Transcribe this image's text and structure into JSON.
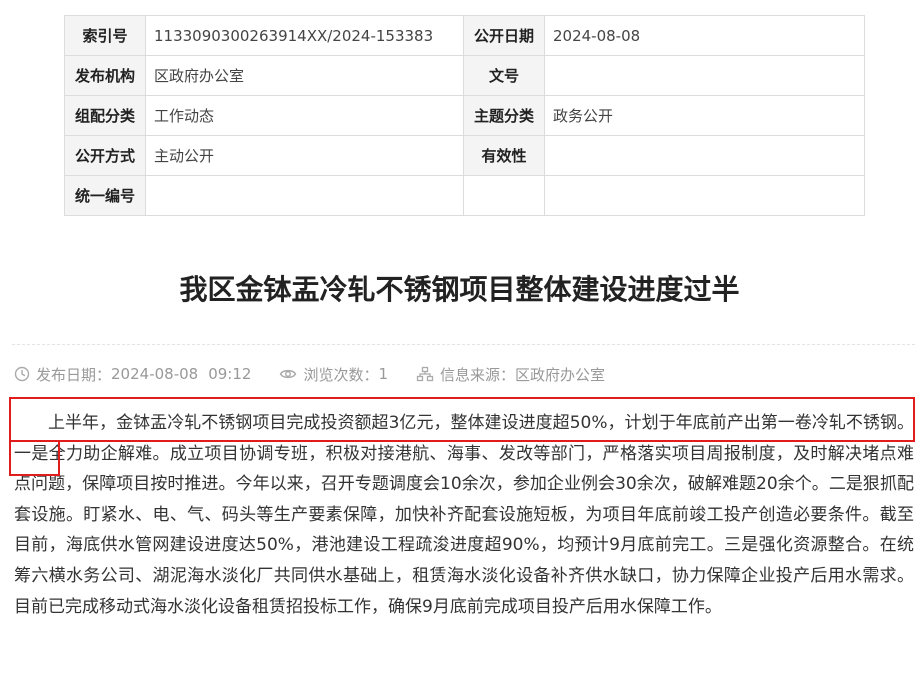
{
  "info_table": {
    "rows": [
      [
        {
          "label": "索引号",
          "value": "113309030026391 4XX/2024-153383"
        },
        {
          "label": "公开日期",
          "value": "2024-08-08"
        }
      ],
      [
        {
          "label": "发布机构",
          "value": "区政府办公室"
        },
        {
          "label": "文号",
          "value": ""
        }
      ],
      [
        {
          "label": "组配分类",
          "value": "工作动态"
        },
        {
          "label": "主题分类",
          "value": "政务公开"
        }
      ],
      [
        {
          "label": "公开方式",
          "value": "主动公开"
        },
        {
          "label": "有效性",
          "value": ""
        }
      ],
      [
        {
          "label": "统一编号",
          "value": ""
        },
        {
          "label": "",
          "value": ""
        }
      ]
    ]
  },
  "article": {
    "title": "我区金钵盂冷轧不锈钢项目整体建设进度过半",
    "meta": {
      "publish_label": "发布日期：",
      "publish_date": "2024-08-08",
      "publish_time": "09:12",
      "views_label": "浏览次数：",
      "views": "1",
      "source_label": "信息来源：",
      "source": "区政府办公室"
    },
    "highlighted_text": "上半年，金钵盂冷轧不锈钢项目完成投资额超3亿元，整体建设进度超50%，计划于年底前产出第一卷冷轧不锈钢。",
    "body_rest": "一是全力助企解难。成立项目协调专班，积极对接港航、海事、发改等部门，严格落实项目周报制度，及时解决堵点难点问题，保障项目按时推进。今年以来，召开专题调度会10余次，参加企业例会30余次，破解难题20余个。二是狠抓配套设施。盯紧水、电、气、码头等生产要素保障，加快补齐配套设施短板，为项目年底前竣工投产创造必要条件。截至目前，海底供水管网建设进度达50%，港池建设工程疏浚进度超90%，均预计9月底前完工。三是强化资源整合。在统筹六横水务公司、湖泥海水淡化厂共同供水基础上，租赁海水淡化设备补齐供水缺口，协力保障企业投产后用水需求。目前已完成移动式海水淡化设备租赁招投标工作，确保9月底前完成项目投产后用水保障工作。"
  },
  "colors": {
    "highlight_border": "#e11c1c",
    "label_bg": "#f4f4f4",
    "meta_text": "#999999"
  }
}
